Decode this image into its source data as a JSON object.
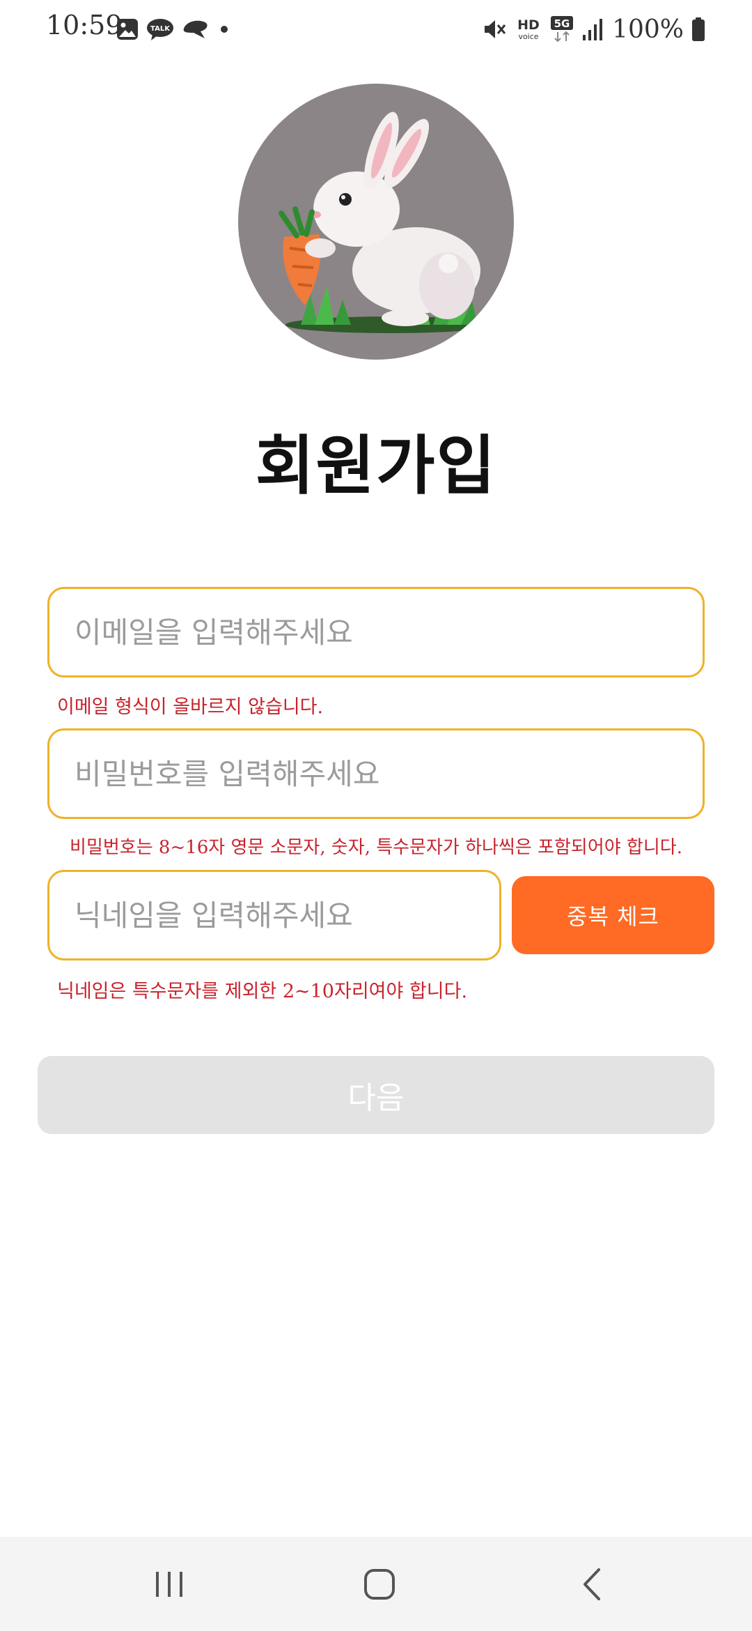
{
  "status_bar": {
    "time": "10:59",
    "left_icons": [
      "gallery-icon",
      "kakaotalk-icon",
      "line-icon",
      "notification-dot-icon"
    ],
    "kakao_label": "TALK",
    "right_icons": [
      "mute-icon",
      "hd-voice-icon",
      "5g-icon",
      "signal-icon",
      "battery-icon"
    ],
    "hd_label": "HD",
    "voice_label": "voice",
    "network_label": "5G",
    "battery": "100%"
  },
  "avatar": {
    "icon": "rabbit-with-carrot-avatar",
    "background": "#8c8588"
  },
  "title": "회원가입",
  "form": {
    "email": {
      "value": "",
      "placeholder": "이메일을 입력해주세요",
      "error": "이메일 형식이 올바르지 않습니다."
    },
    "password": {
      "value": "",
      "placeholder": "비밀번호를 입력해주세요",
      "error": "비밀번호는 8~16자 영문 소문자, 숫자, 특수문자가 하나씩은 포함되어야 합니다."
    },
    "nickname": {
      "value": "",
      "placeholder": "닉네임을 입력해주세요",
      "error": "닉네임은 특수문자를 제외한 2~10자리여야 합니다."
    },
    "duplicate_check_label": "중복 체크",
    "next_label": "다음"
  },
  "colors": {
    "field_border": "#f0b22a",
    "accent": "#ff6a24",
    "error": "#c8232c",
    "disabled_button": "#e3e3e3"
  },
  "nav_bar": {
    "buttons": [
      "recents-icon",
      "home-icon",
      "back-icon"
    ]
  }
}
